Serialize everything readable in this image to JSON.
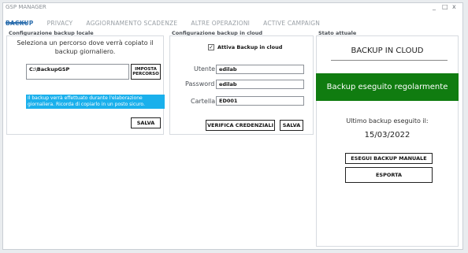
{
  "window": {
    "title": "GSP MANAGER",
    "minimize": "_",
    "maximize": "□",
    "close": "x"
  },
  "tabs": [
    {
      "label": "BACKUP"
    },
    {
      "label": "PRIVACY"
    },
    {
      "label": "AGGIORNAMENTO SCADENZE"
    },
    {
      "label": "ALTRE OPERAZIONI"
    },
    {
      "label": "ACTIVE CAMPAIGN"
    }
  ],
  "local_backup": {
    "title": "Configurazione backup locale",
    "instruction": "Seleziona un percorso dove verrà copiato il backup giornaliero.",
    "path_value": "C:\\BackupGSP",
    "set_path_button": "IMPOSTA PERCORSO",
    "info_text": "Il backup verrà effettuato durante l'elaborazione giornaliera. Ricorda di copiarlo in un posto sicuro.",
    "save_button": "SALVA"
  },
  "cloud_backup": {
    "title": "Configurazione backup in cloud",
    "enable_label": "Attiva Backup in cloud",
    "enable_checked": true,
    "user_label": "Utente",
    "user_value": "edilab",
    "password_label": "Password",
    "password_value": "edilab",
    "folder_label": "Cartella",
    "folder_value": "ED001",
    "verify_button": "VERIFICA CREDENZIALI",
    "save_button": "SALVA"
  },
  "status": {
    "title": "Stato attuale",
    "mode": "BACKUP IN CLOUD",
    "result": "Backup eseguito regolarmente",
    "result_color": "#107c10",
    "last_label": "Ultimo backup eseguito il:",
    "last_date": "15/03/2022",
    "manual_button": "ESEGUI BACKUP MANUALE",
    "export_button": "ESPORTA"
  }
}
